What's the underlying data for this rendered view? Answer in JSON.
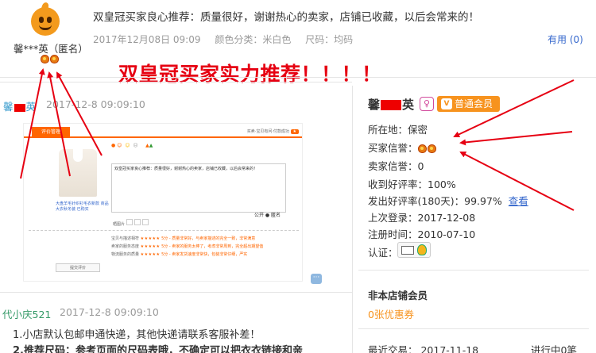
{
  "review": {
    "user": "馨***英（匿名）",
    "text": "双皇冠买家良心推荐：质量很好，谢谢热心的卖家，店铺已收藏，以后会常来的！",
    "date": "2017年12月08日 09:09",
    "color": "颜色分类：米白色",
    "size": "尺码：均码",
    "useful": "有用 (0)"
  },
  "headline": "双皇冠买家实力推荐！！！！",
  "left": {
    "reviewer1_name_prefix": "馨",
    "reviewer1_name_suffix": "英",
    "reviewer1_date": "2017-12-8 09:09:10",
    "embedded": {
      "tab": "评价管理",
      "right_text": "买卖·宝贝有问·付款成功",
      "product": "大盘羊毛针织衫毛衣新款 商品大衣秋冬装 已购买",
      "stars_label": "评价",
      "comment": "双皇冠买家良心推荐：质量很好，谢谢热心的卖家，店铺已收藏，以后会常来的！",
      "photo_label": "晒图片",
      "anon_label": "公开  ● 匿名",
      "button": "提交评价",
      "ratings": [
        {
          "label": "宝贝与描述相符",
          "tip": "5分 - 质量非常好，与卖家描述的完全一致，非常满意"
        },
        {
          "label": "卖家的服务态度",
          "tip": "5分 - 卖家的服务太棒了，考虑非常周到，完全超出期望值"
        },
        {
          "label": "物流服务的质量",
          "tip": "5分 - 卖家发货速度非常快，包装非常仔细，严实"
        }
      ]
    },
    "reviewer2_name": "代小庆521",
    "reviewer2_date": "2017-12-8 09:09:10",
    "line1": "1.小店默认包邮申通快递，其他快递请联系客服补差！",
    "line2": "2.推荐尺码：参考页面的尺码表哦，不确定可以把衣衣链接和亲"
  },
  "right": {
    "name_prefix": "馨",
    "name_suffix": "英",
    "gender_icon": "♀",
    "member_label": "普通会员",
    "location": "所在地：保密",
    "buyer_credit": "买家信誉：",
    "seller_credit": "卖家信誉：0",
    "received_rate": "收到好评率：100%",
    "sent_rate": "发出好评率(180天)：99.97%",
    "view_link": "查看",
    "last_login": "上次登录：2017-12-08",
    "reg_time": "注册时间：2010-07-10",
    "auth": "认证：",
    "non_member": "非本店铺会员",
    "coupons": "0张优惠券",
    "last_trade": "最近交易：  2017-11-18",
    "ongoing": "进行中0笔"
  },
  "colors": {
    "annotation_red": "#e60012",
    "member_orange": "#f7931e",
    "link_blue": "#3366cc"
  }
}
